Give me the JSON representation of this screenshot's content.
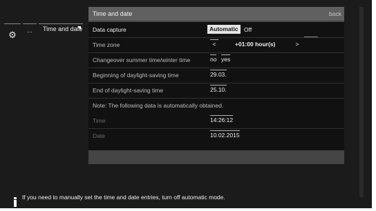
{
  "breadcrumb": {
    "gear_icon": "gear-icon",
    "ellipsis": "...",
    "current": "Time and date"
  },
  "panel": {
    "title": "Time and date",
    "back_label": "back"
  },
  "rows": {
    "data_capture": {
      "label": "Data capture",
      "option_on": "Automatic",
      "option_off": "Off"
    },
    "time_zone": {
      "label": "Time zone",
      "prev": "<",
      "value": "+01:00 hour(s)",
      "next": ">"
    },
    "changeover": {
      "label": "Changeover summer time/winter time",
      "option_no": "no",
      "option_yes": "yes"
    },
    "dst_begin": {
      "label": "Beginning of daylight-saving time",
      "value": "29.03."
    },
    "dst_end": {
      "label": "End of daylight-saving time",
      "value": "25.10."
    },
    "note": {
      "text": "Note: The following data is automatically obtained."
    },
    "time": {
      "label": "Time",
      "value": "14:26:12"
    },
    "date": {
      "label": "Date",
      "value": "10.02.2015"
    }
  },
  "footer": {
    "info_icon": "info-icon",
    "text": "If you need to manually set the time and date entries, turn off automatic mode."
  }
}
